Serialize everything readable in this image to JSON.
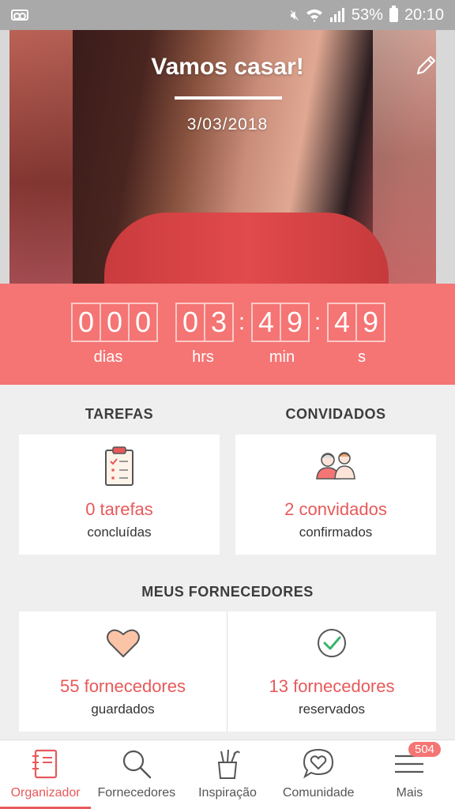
{
  "status_bar": {
    "battery": "53%",
    "time": "20:10"
  },
  "hero": {
    "title": "Vamos casar!",
    "date": "3/03/2018"
  },
  "countdown": {
    "days": [
      "0",
      "0",
      "0"
    ],
    "hours": [
      "0",
      "3"
    ],
    "minutes": [
      "4",
      "9"
    ],
    "seconds": [
      "4",
      "9"
    ],
    "separator": ":",
    "labels": {
      "days": "dias",
      "hours": "hrs",
      "minutes": "min",
      "seconds": "s"
    }
  },
  "tasks": {
    "title": "TAREFAS",
    "value": "0 tarefas",
    "caption": "concluídas"
  },
  "guests": {
    "title": "CONVIDADOS",
    "value": "2 convidados",
    "caption": "confirmados"
  },
  "vendors": {
    "title": "MEUS FORNECEDORES",
    "saved": {
      "value": "55 fornecedores",
      "caption": "guardados"
    },
    "booked": {
      "value": "13 fornecedores",
      "caption": "reservados"
    }
  },
  "nav": {
    "items": [
      {
        "label": "Organizador",
        "icon": "notebook-icon",
        "active": true
      },
      {
        "label": "Fornecedores",
        "icon": "search-icon"
      },
      {
        "label": "Inspiração",
        "icon": "brushes-icon"
      },
      {
        "label": "Comunidade",
        "icon": "heart-chat-icon"
      },
      {
        "label": "Mais",
        "icon": "menu-icon",
        "badge": "504"
      }
    ]
  },
  "colors": {
    "accent": "#f47574",
    "accent_text": "#e8595a",
    "status_bar": "#a9a9a9"
  }
}
